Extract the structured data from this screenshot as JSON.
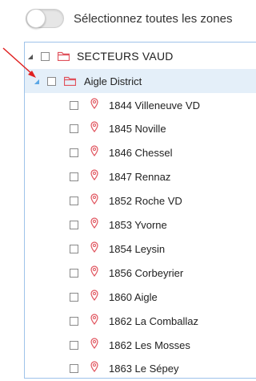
{
  "toggle": {
    "label": "Sélectionnez toutes les zones",
    "on": false
  },
  "tree": {
    "root": {
      "label": "SECTEURS VAUD"
    },
    "district": {
      "label": "Aigle District"
    },
    "items": [
      {
        "label": "1844 Villeneuve VD"
      },
      {
        "label": "1845 Noville"
      },
      {
        "label": "1846 Chessel"
      },
      {
        "label": "1847 Rennaz"
      },
      {
        "label": "1852 Roche VD"
      },
      {
        "label": "1853 Yvorne"
      },
      {
        "label": "1854 Leysin"
      },
      {
        "label": "1856 Corbeyrier"
      },
      {
        "label": "1860 Aigle"
      },
      {
        "label": "1862 La Comballaz"
      },
      {
        "label": "1862 Les Mosses"
      },
      {
        "label": "1863 Le Sépey"
      }
    ]
  },
  "colors": {
    "folder": "#e0525c",
    "pin": "#e0525c",
    "selection": "#e4eff9",
    "arrow": "#e02020"
  }
}
